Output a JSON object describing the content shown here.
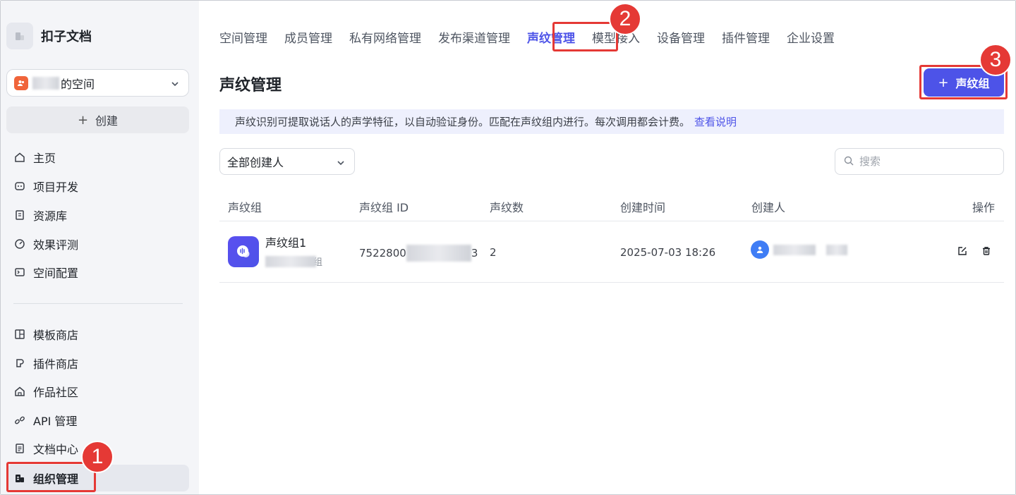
{
  "brand": {
    "name": "扣子文档"
  },
  "space": {
    "name": "的空间"
  },
  "sidebar": {
    "create_label": "创建",
    "items": [
      {
        "label": "主页",
        "icon": "home-icon"
      },
      {
        "label": "项目开发",
        "icon": "bot-icon"
      },
      {
        "label": "资源库",
        "icon": "library-icon"
      },
      {
        "label": "效果评测",
        "icon": "gauge-icon"
      },
      {
        "label": "空间配置",
        "icon": "terminal-icon"
      },
      {
        "label": "模板商店",
        "icon": "template-icon"
      },
      {
        "label": "插件商店",
        "icon": "plugin-icon"
      },
      {
        "label": "作品社区",
        "icon": "community-icon"
      },
      {
        "label": "API 管理",
        "icon": "link-icon"
      },
      {
        "label": "文档中心",
        "icon": "doc-icon"
      },
      {
        "label": "组织管理",
        "icon": "building-icon"
      }
    ]
  },
  "tabs": [
    "空间管理",
    "成员管理",
    "私有网络管理",
    "发布渠道管理",
    "声纹管理",
    "模型接入",
    "设备管理",
    "插件管理",
    "企业设置"
  ],
  "page": {
    "title": "声纹管理",
    "primary_button": "声纹组",
    "info_text": "声纹识别可提取说话人的声学特征，以自动验证身份。匹配在声纹组内进行。每次调用都会计费。",
    "info_link": "查看说明",
    "filter_value": "全部创建人",
    "search_placeholder": "搜索"
  },
  "table": {
    "columns": [
      "声纹组",
      "声纹组 ID",
      "声纹数",
      "创建时间",
      "创建人",
      "操作"
    ],
    "rows": [
      {
        "name": "声纹组1",
        "desc_tail": "组",
        "id_head": "7522800",
        "id_tail": "3",
        "count": "2",
        "created_at": "2025-07-03 18:26"
      }
    ]
  },
  "annotations": [
    "1",
    "2",
    "3"
  ],
  "colors": {
    "accent": "#4d53e8",
    "annotation": "#e53935"
  }
}
